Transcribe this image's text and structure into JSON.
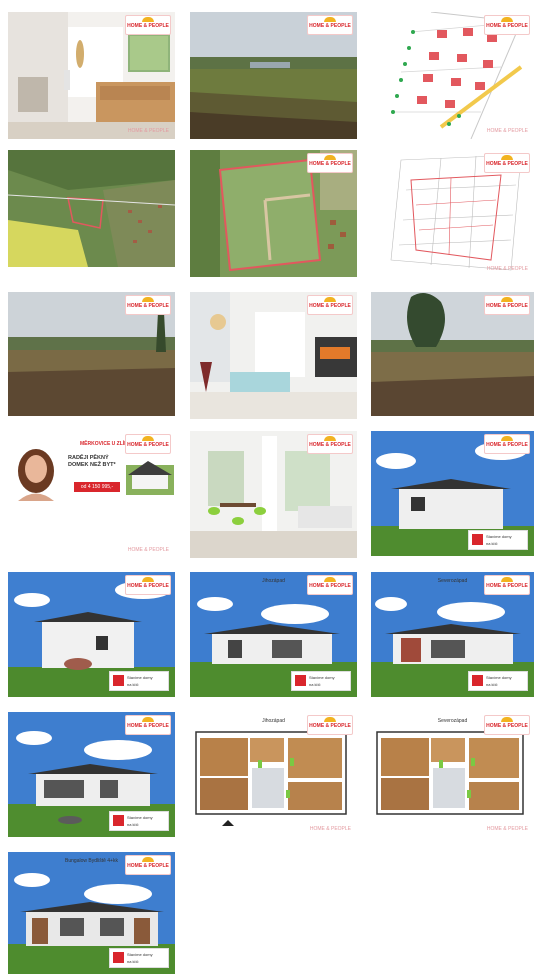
{
  "gallery": {
    "logo_text": "HOME & PEOPLE",
    "watermark_text": "HOME & PEOPLE",
    "badge": {
      "line1": "Stavíme domy",
      "line2": "na klíč"
    },
    "promo": {
      "head": "MĚRKOVICE U ZLÍNA",
      "title": "RADĚJI PĚKNÝ DOMEK NEŽ BYT*",
      "price": "od 4 150 995,-"
    },
    "view_labels": {
      "front": "Jihozápad",
      "rear": "Severozápad"
    },
    "tile_last_label": "Bungalow Bydliště 4+kk",
    "tiles": [
      {
        "kind": "interior-kitchen",
        "alt": "Interiér kuchyně"
      },
      {
        "kind": "field",
        "alt": "Pozemek"
      },
      {
        "kind": "site-plan",
        "alt": "Situace"
      },
      {
        "kind": "aerial",
        "alt": "Letecký pohled"
      },
      {
        "kind": "aerial-close",
        "alt": "Letecký pohled detail"
      },
      {
        "kind": "site-plan-2",
        "alt": "Situace parcel"
      },
      {
        "kind": "field",
        "alt": "Pozemek"
      },
      {
        "kind": "interior-living",
        "alt": "Obývací pokoj"
      },
      {
        "kind": "field-tree",
        "alt": "Pozemek se stromy"
      },
      {
        "kind": "promo",
        "alt": "Reklama"
      },
      {
        "kind": "interior-dining",
        "alt": "Jídelna"
      },
      {
        "kind": "house-side",
        "alt": "Vizualizace domu"
      },
      {
        "kind": "house-side-2",
        "alt": "Vizualizace domu"
      },
      {
        "kind": "house-front",
        "alt": "Vizualizace domu"
      },
      {
        "kind": "house-front-2",
        "alt": "Vizualizace domu"
      },
      {
        "kind": "house-rear",
        "alt": "Vizualizace domu"
      },
      {
        "kind": "floorplan",
        "alt": "Půdorys"
      },
      {
        "kind": "floorplan",
        "alt": "Půdorys"
      },
      {
        "kind": "house-double",
        "alt": "Vizualizace dvojdomu"
      }
    ]
  }
}
